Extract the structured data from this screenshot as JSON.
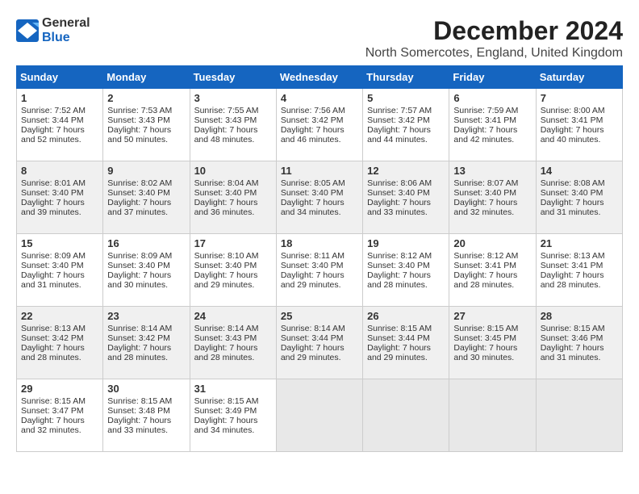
{
  "logo": {
    "general": "General",
    "blue": "Blue"
  },
  "title": "December 2024",
  "subtitle": "North Somercotes, England, United Kingdom",
  "days_of_week": [
    "Sunday",
    "Monday",
    "Tuesday",
    "Wednesday",
    "Thursday",
    "Friday",
    "Saturday"
  ],
  "weeks": [
    [
      {
        "day": "1",
        "sunrise": "Sunrise: 7:52 AM",
        "sunset": "Sunset: 3:44 PM",
        "daylight": "Daylight: 7 hours and 52 minutes."
      },
      {
        "day": "2",
        "sunrise": "Sunrise: 7:53 AM",
        "sunset": "Sunset: 3:43 PM",
        "daylight": "Daylight: 7 hours and 50 minutes."
      },
      {
        "day": "3",
        "sunrise": "Sunrise: 7:55 AM",
        "sunset": "Sunset: 3:43 PM",
        "daylight": "Daylight: 7 hours and 48 minutes."
      },
      {
        "day": "4",
        "sunrise": "Sunrise: 7:56 AM",
        "sunset": "Sunset: 3:42 PM",
        "daylight": "Daylight: 7 hours and 46 minutes."
      },
      {
        "day": "5",
        "sunrise": "Sunrise: 7:57 AM",
        "sunset": "Sunset: 3:42 PM",
        "daylight": "Daylight: 7 hours and 44 minutes."
      },
      {
        "day": "6",
        "sunrise": "Sunrise: 7:59 AM",
        "sunset": "Sunset: 3:41 PM",
        "daylight": "Daylight: 7 hours and 42 minutes."
      },
      {
        "day": "7",
        "sunrise": "Sunrise: 8:00 AM",
        "sunset": "Sunset: 3:41 PM",
        "daylight": "Daylight: 7 hours and 40 minutes."
      }
    ],
    [
      {
        "day": "8",
        "sunrise": "Sunrise: 8:01 AM",
        "sunset": "Sunset: 3:40 PM",
        "daylight": "Daylight: 7 hours and 39 minutes."
      },
      {
        "day": "9",
        "sunrise": "Sunrise: 8:02 AM",
        "sunset": "Sunset: 3:40 PM",
        "daylight": "Daylight: 7 hours and 37 minutes."
      },
      {
        "day": "10",
        "sunrise": "Sunrise: 8:04 AM",
        "sunset": "Sunset: 3:40 PM",
        "daylight": "Daylight: 7 hours and 36 minutes."
      },
      {
        "day": "11",
        "sunrise": "Sunrise: 8:05 AM",
        "sunset": "Sunset: 3:40 PM",
        "daylight": "Daylight: 7 hours and 34 minutes."
      },
      {
        "day": "12",
        "sunrise": "Sunrise: 8:06 AM",
        "sunset": "Sunset: 3:40 PM",
        "daylight": "Daylight: 7 hours and 33 minutes."
      },
      {
        "day": "13",
        "sunrise": "Sunrise: 8:07 AM",
        "sunset": "Sunset: 3:40 PM",
        "daylight": "Daylight: 7 hours and 32 minutes."
      },
      {
        "day": "14",
        "sunrise": "Sunrise: 8:08 AM",
        "sunset": "Sunset: 3:40 PM",
        "daylight": "Daylight: 7 hours and 31 minutes."
      }
    ],
    [
      {
        "day": "15",
        "sunrise": "Sunrise: 8:09 AM",
        "sunset": "Sunset: 3:40 PM",
        "daylight": "Daylight: 7 hours and 31 minutes."
      },
      {
        "day": "16",
        "sunrise": "Sunrise: 8:09 AM",
        "sunset": "Sunset: 3:40 PM",
        "daylight": "Daylight: 7 hours and 30 minutes."
      },
      {
        "day": "17",
        "sunrise": "Sunrise: 8:10 AM",
        "sunset": "Sunset: 3:40 PM",
        "daylight": "Daylight: 7 hours and 29 minutes."
      },
      {
        "day": "18",
        "sunrise": "Sunrise: 8:11 AM",
        "sunset": "Sunset: 3:40 PM",
        "daylight": "Daylight: 7 hours and 29 minutes."
      },
      {
        "day": "19",
        "sunrise": "Sunrise: 8:12 AM",
        "sunset": "Sunset: 3:40 PM",
        "daylight": "Daylight: 7 hours and 28 minutes."
      },
      {
        "day": "20",
        "sunrise": "Sunrise: 8:12 AM",
        "sunset": "Sunset: 3:41 PM",
        "daylight": "Daylight: 7 hours and 28 minutes."
      },
      {
        "day": "21",
        "sunrise": "Sunrise: 8:13 AM",
        "sunset": "Sunset: 3:41 PM",
        "daylight": "Daylight: 7 hours and 28 minutes."
      }
    ],
    [
      {
        "day": "22",
        "sunrise": "Sunrise: 8:13 AM",
        "sunset": "Sunset: 3:42 PM",
        "daylight": "Daylight: 7 hours and 28 minutes."
      },
      {
        "day": "23",
        "sunrise": "Sunrise: 8:14 AM",
        "sunset": "Sunset: 3:42 PM",
        "daylight": "Daylight: 7 hours and 28 minutes."
      },
      {
        "day": "24",
        "sunrise": "Sunrise: 8:14 AM",
        "sunset": "Sunset: 3:43 PM",
        "daylight": "Daylight: 7 hours and 28 minutes."
      },
      {
        "day": "25",
        "sunrise": "Sunrise: 8:14 AM",
        "sunset": "Sunset: 3:44 PM",
        "daylight": "Daylight: 7 hours and 29 minutes."
      },
      {
        "day": "26",
        "sunrise": "Sunrise: 8:15 AM",
        "sunset": "Sunset: 3:44 PM",
        "daylight": "Daylight: 7 hours and 29 minutes."
      },
      {
        "day": "27",
        "sunrise": "Sunrise: 8:15 AM",
        "sunset": "Sunset: 3:45 PM",
        "daylight": "Daylight: 7 hours and 30 minutes."
      },
      {
        "day": "28",
        "sunrise": "Sunrise: 8:15 AM",
        "sunset": "Sunset: 3:46 PM",
        "daylight": "Daylight: 7 hours and 31 minutes."
      }
    ],
    [
      {
        "day": "29",
        "sunrise": "Sunrise: 8:15 AM",
        "sunset": "Sunset: 3:47 PM",
        "daylight": "Daylight: 7 hours and 32 minutes."
      },
      {
        "day": "30",
        "sunrise": "Sunrise: 8:15 AM",
        "sunset": "Sunset: 3:48 PM",
        "daylight": "Daylight: 7 hours and 33 minutes."
      },
      {
        "day": "31",
        "sunrise": "Sunrise: 8:15 AM",
        "sunset": "Sunset: 3:49 PM",
        "daylight": "Daylight: 7 hours and 34 minutes."
      },
      null,
      null,
      null,
      null
    ]
  ]
}
